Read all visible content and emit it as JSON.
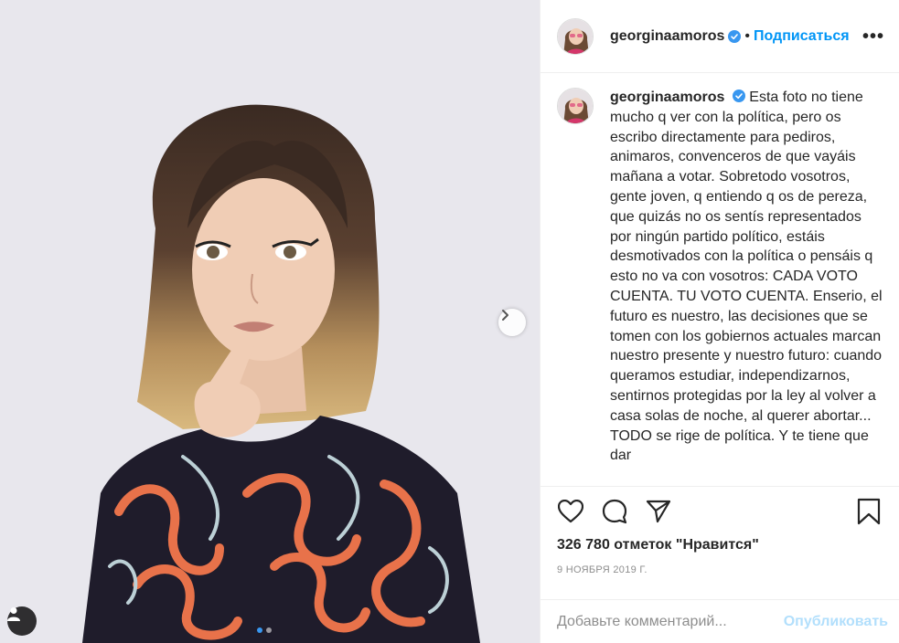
{
  "post": {
    "username": "georginaamoros",
    "verified": true,
    "separator": "•",
    "follow_label": "Подписаться",
    "more_label": "•••",
    "caption": "Esta foto no tiene mucho q ver con la política, pero os escribo directamente para pediros, animaros, convenceros de que vayáis mañana a votar. Sobretodo vosotros, gente joven, q entiendo q os de pereza, que quizás no os sentís representados por ningún partido político, estáis desmotivados con la política o pensáis q esto no va con vosotros: CADA VOTO CUENTA. TU VOTO CUENTA. Enserio, el futuro es nuestro, las decisiones que se tomen con los gobiernos actuales marcan nuestro presente y nuestro futuro: cuando queramos estudiar, independizarnos, sentirnos protegidas por la ley al volver a casa solas de noche, al querer abortar... TODO se rige de política. Y te tiene que dar",
    "likes": "326 780 отметок \"Нравится\"",
    "date": "9 НОЯБРЯ 2019 Г.",
    "comment_placeholder": "Добавьте комментарий...",
    "publish_label": "Опубликовать"
  },
  "carousel": {
    "current_slide": 1,
    "total_slides": 2
  },
  "icons": [
    "heart-icon",
    "comment-icon",
    "share-icon",
    "bookmark-icon",
    "chevron-right-icon",
    "user-tag-icon",
    "verified-badge-icon",
    "more-icon"
  ],
  "colors": {
    "accent": "#0095f6",
    "publish_disabled": "#b2dffc",
    "verified": "#3897f0",
    "text": "#262626",
    "muted": "#8e8e8e"
  }
}
